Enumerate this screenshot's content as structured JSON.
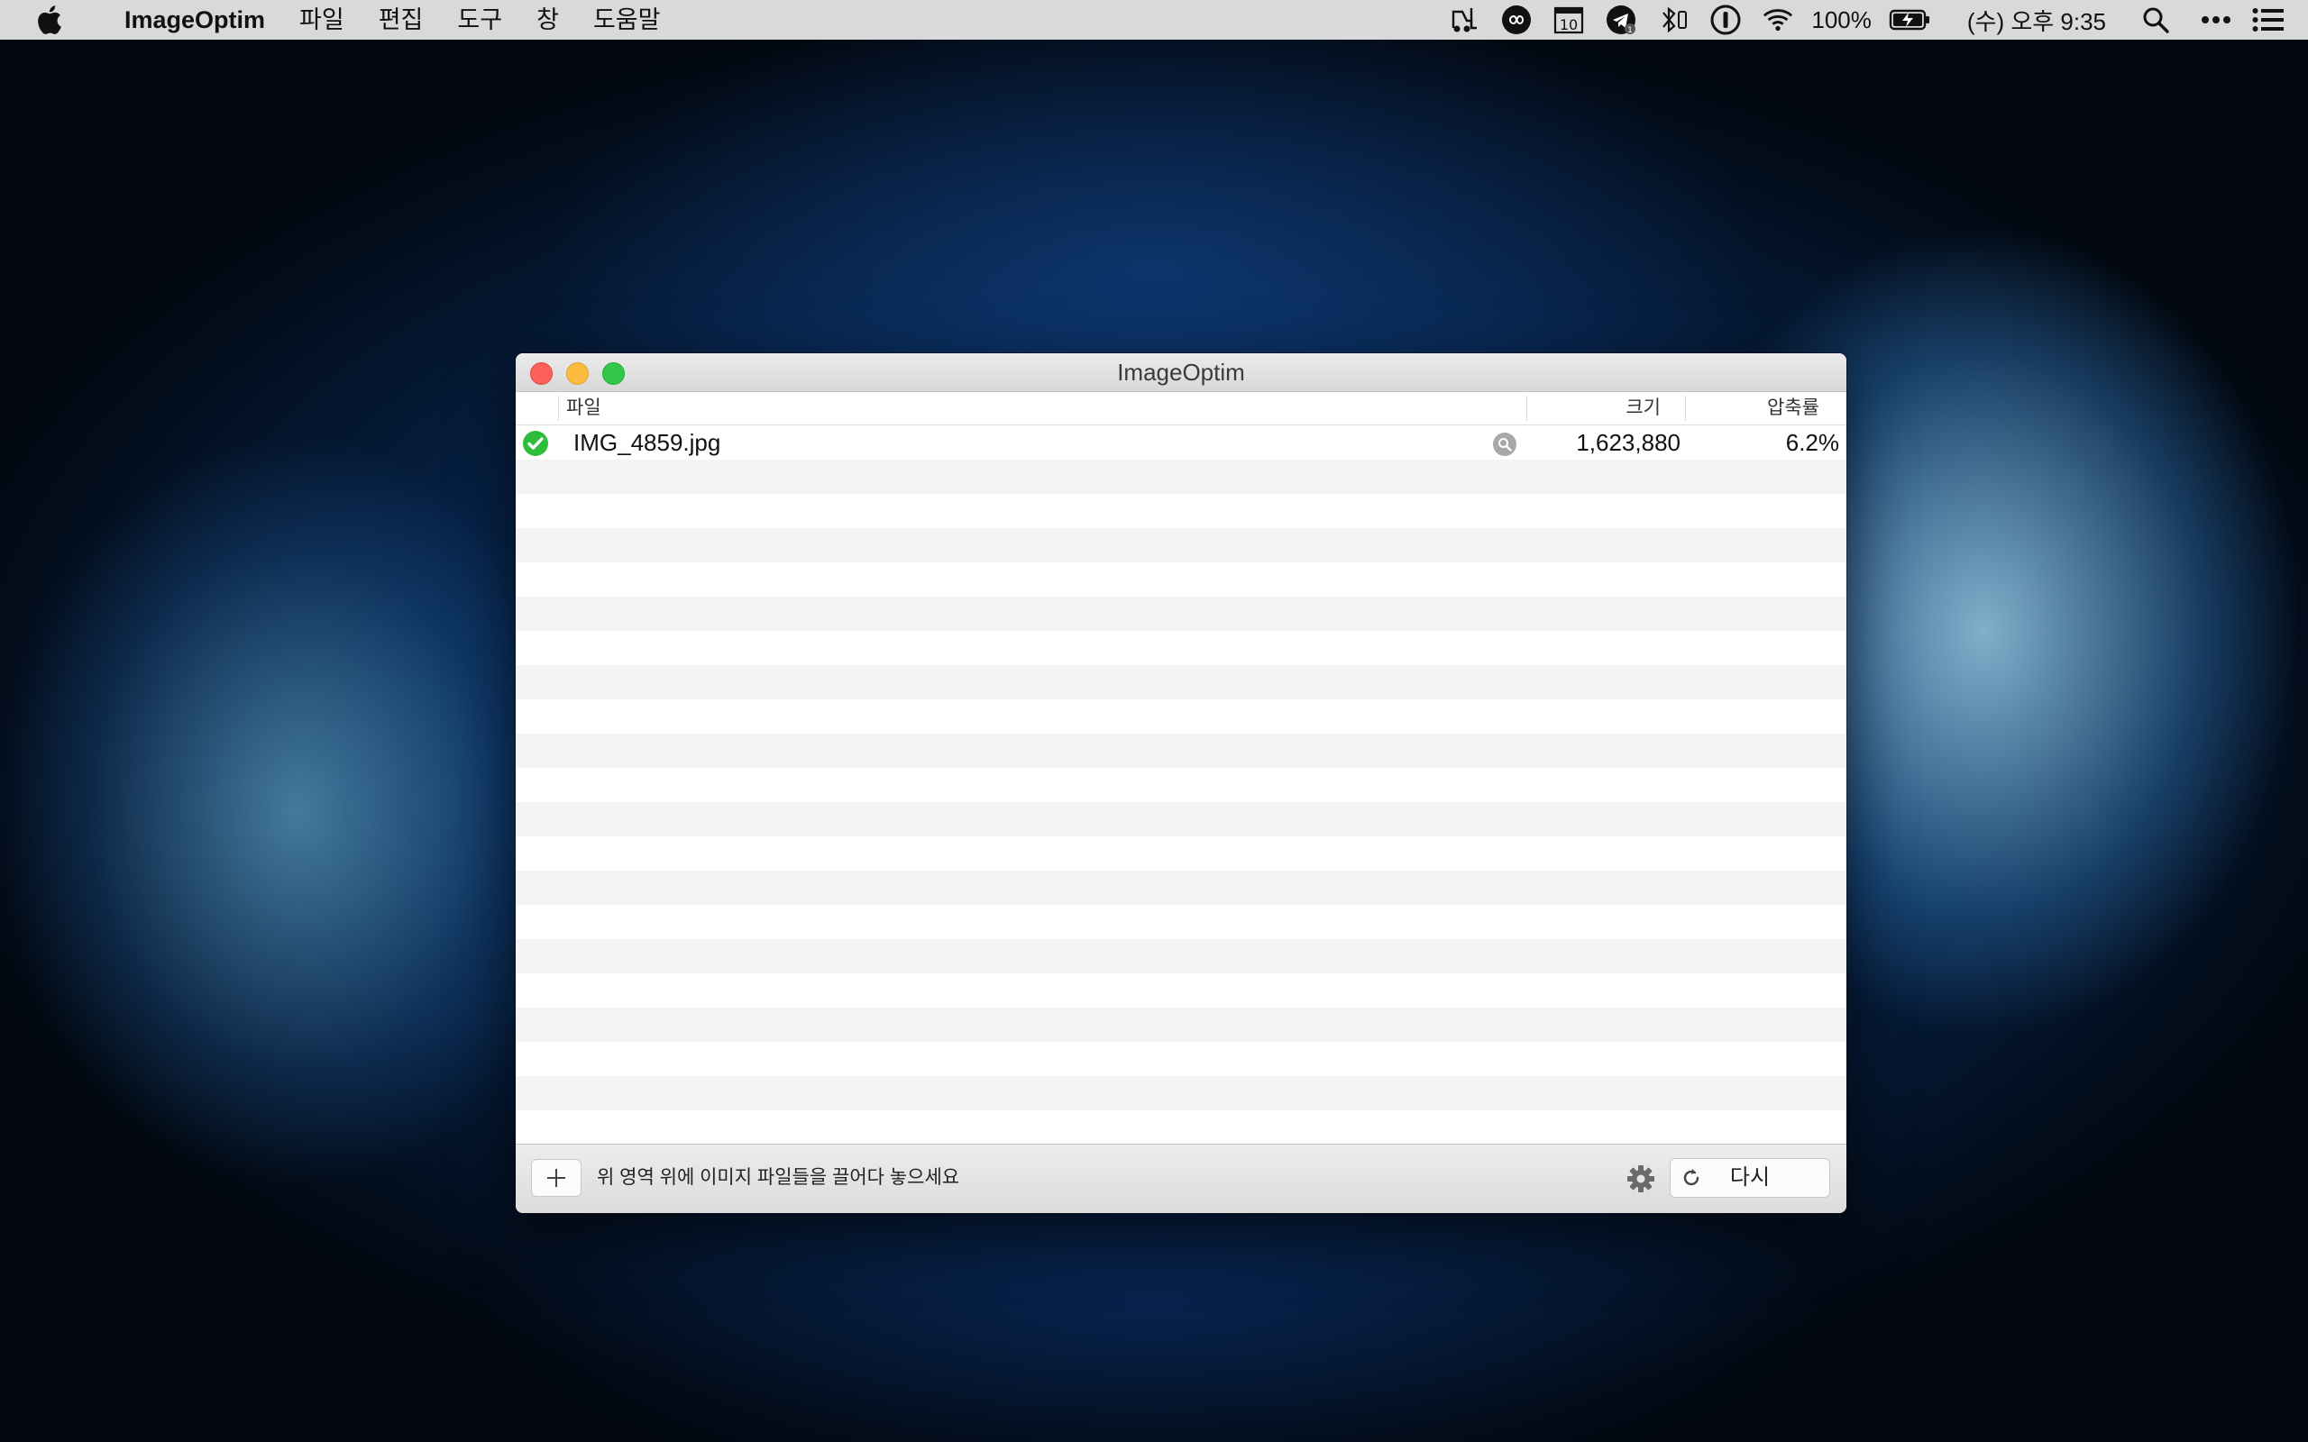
{
  "menubar": {
    "app_name": "ImageOptim",
    "items": [
      "파일",
      "편집",
      "도구",
      "창",
      "도움말"
    ],
    "battery": "100%",
    "clock": "(수) 오후 9:35",
    "calendar_day": "10",
    "tray_icons": [
      "forklift-icon",
      "infinity-icon",
      "calendar-icon",
      "telegram-icon",
      "bluetooth-icon",
      "onepassword-icon",
      "wifi-icon",
      "battery-icon",
      "spotlight-icon",
      "more-icon",
      "notification-center-icon"
    ]
  },
  "window": {
    "title": "ImageOptim",
    "columns": {
      "file": "파일",
      "size": "크기",
      "ratio": "압축률"
    },
    "files": [
      {
        "status": "done",
        "name": "IMG_4859.jpg",
        "size": "1,623,880",
        "ratio": "6.2%"
      }
    ],
    "empty_rows": 20,
    "bottom": {
      "hint": "위 영역 위에 이미지 파일들을 끌어다 놓으세요",
      "again_label": "다시"
    }
  },
  "colors": {
    "close": "#fc605c",
    "minimize": "#fdbc40",
    "maximize": "#34c84a",
    "success": "#2dbd3b"
  }
}
